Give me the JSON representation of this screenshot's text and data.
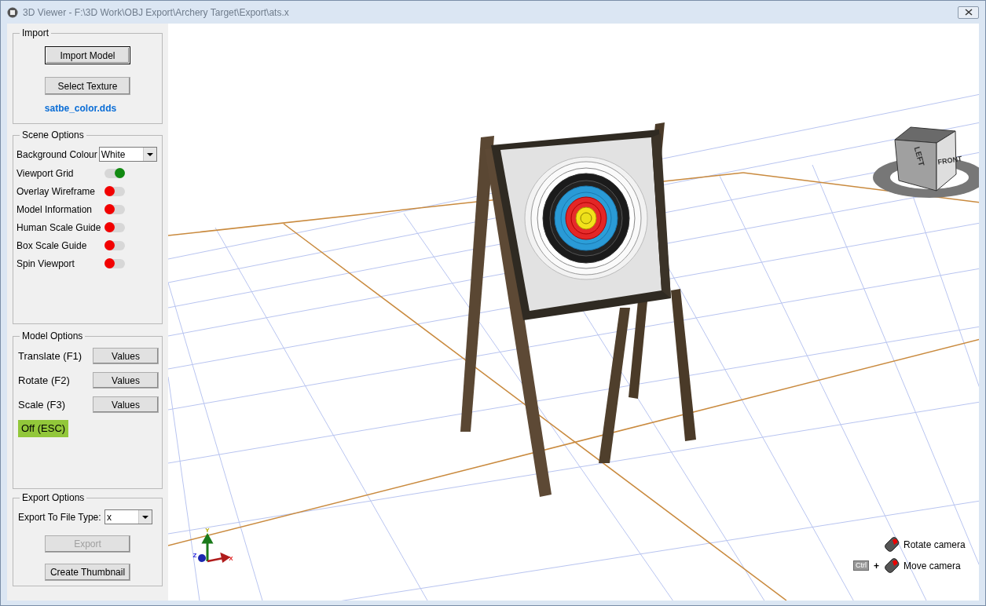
{
  "window": {
    "title": "3D Viewer - F:\\3D Work\\OBJ Export\\Archery Target\\Export\\ats.x"
  },
  "import": {
    "title": "Import",
    "buttons": [
      {
        "label": "Import Model",
        "default": true
      },
      {
        "label": "Select Texture",
        "default": false
      }
    ],
    "texture_file": "satbe_color.dds"
  },
  "scene_options": {
    "title": "Scene Options",
    "background_colour": {
      "label": "Background Colour",
      "value": "White"
    },
    "toggles": [
      {
        "label": "Viewport Grid",
        "on": true
      },
      {
        "label": "Overlay Wireframe",
        "on": false
      },
      {
        "label": "Model Information",
        "on": false
      },
      {
        "label": "Human Scale Guide",
        "on": false
      },
      {
        "label": "Box Scale Guide",
        "on": false
      },
      {
        "label": "Spin Viewport",
        "on": false
      }
    ]
  },
  "model_options": {
    "title": "Model Options",
    "rows": [
      {
        "label": "Translate (F1)",
        "button": "Values"
      },
      {
        "label": "Rotate (F2)",
        "button": "Values"
      },
      {
        "label": "Scale (F3)",
        "button": "Values"
      }
    ],
    "mode_indicator": "Off (ESC)"
  },
  "export_options": {
    "title": "Export Options",
    "file_type": {
      "label": "Export To File Type:",
      "value": "x"
    },
    "buttons": [
      {
        "label": "Export",
        "disabled": true
      },
      {
        "label": "Create Thumbnail",
        "disabled": false
      }
    ]
  },
  "viewport": {
    "view_cube_faces": [
      "FRONT",
      "LEFT"
    ],
    "axes": [
      "Y",
      "Z",
      "X"
    ],
    "hints": [
      {
        "text": "Rotate camera"
      },
      {
        "modifier": "Ctrl",
        "plus": "+",
        "text": "Move camera"
      }
    ]
  }
}
